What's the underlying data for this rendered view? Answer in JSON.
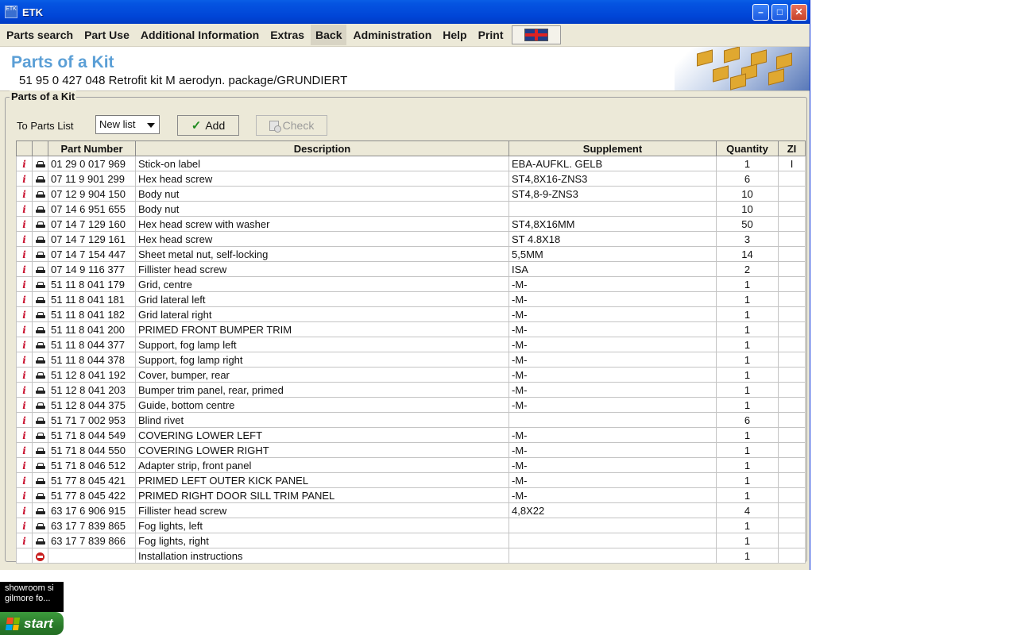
{
  "window": {
    "title": "ETK",
    "app_icon_text": "ETK"
  },
  "menu": [
    {
      "label": "Parts search"
    },
    {
      "label": "Part Use"
    },
    {
      "label": "Additional Information"
    },
    {
      "label": "Extras"
    },
    {
      "label": "Back"
    },
    {
      "label": "Administration"
    },
    {
      "label": "Help"
    },
    {
      "label": "Print"
    }
  ],
  "header": {
    "title": "Parts of a Kit",
    "subtitle": "51 95 0 427 048 Retrofit kit M aerodyn. package/GRUNDIERT"
  },
  "panel": {
    "legend": "Parts of a Kit",
    "to_list_label": "To Parts List",
    "list_select_value": "New list",
    "add_label": "Add",
    "check_label": "Check"
  },
  "table": {
    "headers": [
      "",
      "",
      "Part Number",
      "Description",
      "Supplement",
      "Quantity",
      "ZI"
    ],
    "rows": [
      {
        "icon": "info-icon",
        "vehicle": "car-icon",
        "part": "01 29 0 017 969",
        "desc": "Stick-on label",
        "supp": "EBA-AUFKL. GELB",
        "qty": "1",
        "zi": "I"
      },
      {
        "icon": "info-icon",
        "vehicle": "car-icon",
        "part": "07 11 9 901 299",
        "desc": "Hex head screw",
        "supp": "ST4,8X16-ZNS3",
        "qty": "6",
        "zi": ""
      },
      {
        "icon": "info-icon",
        "vehicle": "car-icon",
        "part": "07 12 9 904 150",
        "desc": "Body nut",
        "supp": "ST4,8-9-ZNS3",
        "qty": "10",
        "zi": ""
      },
      {
        "icon": "info-icon",
        "vehicle": "car-icon",
        "part": "07 14 6 951 655",
        "desc": "Body nut",
        "supp": "",
        "qty": "10",
        "zi": ""
      },
      {
        "icon": "info-icon",
        "vehicle": "car-icon",
        "part": "07 14 7 129 160",
        "desc": "Hex head screw with washer",
        "supp": "ST4,8X16MM",
        "qty": "50",
        "zi": ""
      },
      {
        "icon": "info-icon",
        "vehicle": "car-icon",
        "part": "07 14 7 129 161",
        "desc": "Hex head screw",
        "supp": "ST 4.8X18",
        "qty": "3",
        "zi": ""
      },
      {
        "icon": "info-icon",
        "vehicle": "car-icon",
        "part": "07 14 7 154 447",
        "desc": "Sheet metal nut, self-locking",
        "supp": "5,5MM",
        "qty": "14",
        "zi": ""
      },
      {
        "icon": "info-icon",
        "vehicle": "car-icon",
        "part": "07 14 9 116 377",
        "desc": "Fillister head screw",
        "supp": "ISA",
        "qty": "2",
        "zi": ""
      },
      {
        "icon": "info-icon",
        "vehicle": "car-icon",
        "part": "51 11 8 041 179",
        "desc": "Grid, centre",
        "supp": "-M-",
        "qty": "1",
        "zi": ""
      },
      {
        "icon": "info-icon",
        "vehicle": "car-icon",
        "part": "51 11 8 041 181",
        "desc": "Grid lateral left",
        "supp": "-M-",
        "qty": "1",
        "zi": ""
      },
      {
        "icon": "info-icon",
        "vehicle": "car-icon",
        "part": "51 11 8 041 182",
        "desc": "Grid lateral right",
        "supp": "-M-",
        "qty": "1",
        "zi": ""
      },
      {
        "icon": "info-icon",
        "vehicle": "car-icon",
        "part": "51 11 8 041 200",
        "desc": "PRIMED FRONT BUMPER TRIM",
        "supp": "-M-",
        "qty": "1",
        "zi": ""
      },
      {
        "icon": "info-icon",
        "vehicle": "car-icon",
        "part": "51 11 8 044 377",
        "desc": "Support, fog lamp left",
        "supp": "-M-",
        "qty": "1",
        "zi": ""
      },
      {
        "icon": "info-icon",
        "vehicle": "car-icon",
        "part": "51 11 8 044 378",
        "desc": "Support, fog lamp right",
        "supp": "-M-",
        "qty": "1",
        "zi": ""
      },
      {
        "icon": "info-icon",
        "vehicle": "car-icon",
        "part": "51 12 8 041 192",
        "desc": "Cover, bumper, rear",
        "supp": "-M-",
        "qty": "1",
        "zi": ""
      },
      {
        "icon": "info-icon",
        "vehicle": "car-icon",
        "part": "51 12 8 041 203",
        "desc": "Bumper trim panel, rear, primed",
        "supp": "-M-",
        "qty": "1",
        "zi": ""
      },
      {
        "icon": "info-icon",
        "vehicle": "car-icon",
        "part": "51 12 8 044 375",
        "desc": "Guide, bottom centre",
        "supp": "-M-",
        "qty": "1",
        "zi": ""
      },
      {
        "icon": "info-icon",
        "vehicle": "car-icon",
        "part": "51 71 7 002 953",
        "desc": "Blind rivet",
        "supp": "",
        "qty": "6",
        "zi": ""
      },
      {
        "icon": "info-icon",
        "vehicle": "car-icon",
        "part": "51 71 8 044 549",
        "desc": "COVERING LOWER LEFT",
        "supp": "-M-",
        "qty": "1",
        "zi": ""
      },
      {
        "icon": "info-icon",
        "vehicle": "car-icon",
        "part": "51 71 8 044 550",
        "desc": "COVERING LOWER RIGHT",
        "supp": "-M-",
        "qty": "1",
        "zi": ""
      },
      {
        "icon": "info-icon",
        "vehicle": "car-icon",
        "part": "51 71 8 046 512",
        "desc": "Adapter strip, front panel",
        "supp": "-M-",
        "qty": "1",
        "zi": ""
      },
      {
        "icon": "info-icon",
        "vehicle": "car-icon",
        "part": "51 77 8 045 421",
        "desc": "PRIMED LEFT OUTER KICK PANEL",
        "supp": "-M-",
        "qty": "1",
        "zi": ""
      },
      {
        "icon": "info-icon",
        "vehicle": "car-icon",
        "part": "51 77 8 045 422",
        "desc": "PRIMED RIGHT DOOR SILL TRIM PANEL",
        "supp": "-M-",
        "qty": "1",
        "zi": ""
      },
      {
        "icon": "info-icon",
        "vehicle": "car-icon",
        "part": "63 17 6 906 915",
        "desc": "Fillister head screw",
        "supp": "4,8X22",
        "qty": "4",
        "zi": ""
      },
      {
        "icon": "info-icon",
        "vehicle": "car-icon",
        "part": "63 17 7 839 865",
        "desc": "Fog lights, left",
        "supp": "",
        "qty": "1",
        "zi": ""
      },
      {
        "icon": "info-icon",
        "vehicle": "car-icon",
        "part": "63 17 7 839 866",
        "desc": "Fog lights, right",
        "supp": "",
        "qty": "1",
        "zi": ""
      },
      {
        "icon": "",
        "vehicle": "stop-icon",
        "part": "",
        "desc": "Installation instructions",
        "supp": "",
        "qty": "1",
        "zi": ""
      }
    ]
  },
  "desktop": {
    "shortcut_lines": [
      "showroom si",
      "gilmore fo..."
    ],
    "start_label": "start"
  },
  "colors": {
    "title_accent": "#5b9fd6",
    "info_icon": "#c8102e",
    "titlebar": "#0054e3"
  }
}
